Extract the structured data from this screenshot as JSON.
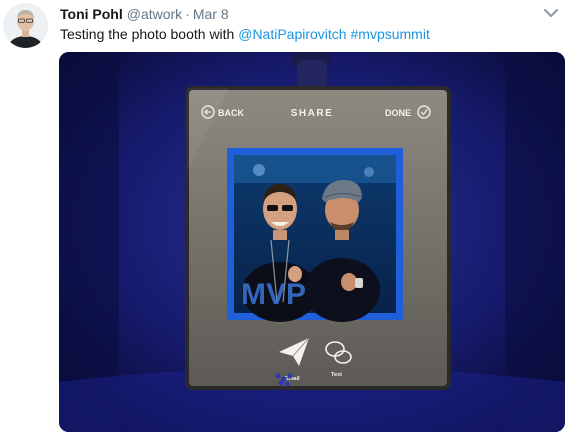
{
  "tweet": {
    "author_name": "Toni Pohl",
    "author_handle": "@atwork",
    "separator": "·",
    "date": "Mar 8",
    "text_prefix": "Testing the photo booth with ",
    "mention": "@NatiPapirovitch",
    "hashtag": "#mvpsummit"
  },
  "booth": {
    "back_label": "BACK",
    "title": "SHARE",
    "done_label": "DONE",
    "email_label": "Email",
    "text_label": "Text",
    "frame_brand": "MVP"
  },
  "colors": {
    "link": "#1b95e0",
    "booth_frame_blue": "#1f5fd9",
    "ambient_blue": "#1a1f7a"
  },
  "icons": {
    "caret": "chevron-down-icon",
    "back": "back-arrow-circle-icon",
    "done": "checkmark-circle-icon",
    "email": "paper-plane-icon",
    "text": "speech-bubbles-icon"
  }
}
